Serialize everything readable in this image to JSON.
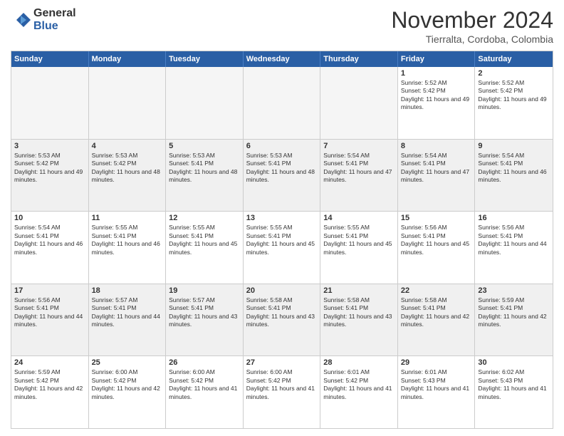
{
  "logo": {
    "general": "General",
    "blue": "Blue"
  },
  "title": "November 2024",
  "location": "Tierralta, Cordoba, Colombia",
  "header_days": [
    "Sunday",
    "Monday",
    "Tuesday",
    "Wednesday",
    "Thursday",
    "Friday",
    "Saturday"
  ],
  "weeks": [
    [
      {
        "day": "",
        "empty": true
      },
      {
        "day": "",
        "empty": true
      },
      {
        "day": "",
        "empty": true
      },
      {
        "day": "",
        "empty": true
      },
      {
        "day": "",
        "empty": true
      },
      {
        "day": "1",
        "sunrise": "Sunrise: 5:52 AM",
        "sunset": "Sunset: 5:42 PM",
        "daylight": "Daylight: 11 hours and 49 minutes."
      },
      {
        "day": "2",
        "sunrise": "Sunrise: 5:52 AM",
        "sunset": "Sunset: 5:42 PM",
        "daylight": "Daylight: 11 hours and 49 minutes."
      }
    ],
    [
      {
        "day": "3",
        "sunrise": "Sunrise: 5:53 AM",
        "sunset": "Sunset: 5:42 PM",
        "daylight": "Daylight: 11 hours and 49 minutes."
      },
      {
        "day": "4",
        "sunrise": "Sunrise: 5:53 AM",
        "sunset": "Sunset: 5:42 PM",
        "daylight": "Daylight: 11 hours and 48 minutes."
      },
      {
        "day": "5",
        "sunrise": "Sunrise: 5:53 AM",
        "sunset": "Sunset: 5:41 PM",
        "daylight": "Daylight: 11 hours and 48 minutes."
      },
      {
        "day": "6",
        "sunrise": "Sunrise: 5:53 AM",
        "sunset": "Sunset: 5:41 PM",
        "daylight": "Daylight: 11 hours and 48 minutes."
      },
      {
        "day": "7",
        "sunrise": "Sunrise: 5:54 AM",
        "sunset": "Sunset: 5:41 PM",
        "daylight": "Daylight: 11 hours and 47 minutes."
      },
      {
        "day": "8",
        "sunrise": "Sunrise: 5:54 AM",
        "sunset": "Sunset: 5:41 PM",
        "daylight": "Daylight: 11 hours and 47 minutes."
      },
      {
        "day": "9",
        "sunrise": "Sunrise: 5:54 AM",
        "sunset": "Sunset: 5:41 PM",
        "daylight": "Daylight: 11 hours and 46 minutes."
      }
    ],
    [
      {
        "day": "10",
        "sunrise": "Sunrise: 5:54 AM",
        "sunset": "Sunset: 5:41 PM",
        "daylight": "Daylight: 11 hours and 46 minutes."
      },
      {
        "day": "11",
        "sunrise": "Sunrise: 5:55 AM",
        "sunset": "Sunset: 5:41 PM",
        "daylight": "Daylight: 11 hours and 46 minutes."
      },
      {
        "day": "12",
        "sunrise": "Sunrise: 5:55 AM",
        "sunset": "Sunset: 5:41 PM",
        "daylight": "Daylight: 11 hours and 45 minutes."
      },
      {
        "day": "13",
        "sunrise": "Sunrise: 5:55 AM",
        "sunset": "Sunset: 5:41 PM",
        "daylight": "Daylight: 11 hours and 45 minutes."
      },
      {
        "day": "14",
        "sunrise": "Sunrise: 5:55 AM",
        "sunset": "Sunset: 5:41 PM",
        "daylight": "Daylight: 11 hours and 45 minutes."
      },
      {
        "day": "15",
        "sunrise": "Sunrise: 5:56 AM",
        "sunset": "Sunset: 5:41 PM",
        "daylight": "Daylight: 11 hours and 45 minutes."
      },
      {
        "day": "16",
        "sunrise": "Sunrise: 5:56 AM",
        "sunset": "Sunset: 5:41 PM",
        "daylight": "Daylight: 11 hours and 44 minutes."
      }
    ],
    [
      {
        "day": "17",
        "sunrise": "Sunrise: 5:56 AM",
        "sunset": "Sunset: 5:41 PM",
        "daylight": "Daylight: 11 hours and 44 minutes."
      },
      {
        "day": "18",
        "sunrise": "Sunrise: 5:57 AM",
        "sunset": "Sunset: 5:41 PM",
        "daylight": "Daylight: 11 hours and 44 minutes."
      },
      {
        "day": "19",
        "sunrise": "Sunrise: 5:57 AM",
        "sunset": "Sunset: 5:41 PM",
        "daylight": "Daylight: 11 hours and 43 minutes."
      },
      {
        "day": "20",
        "sunrise": "Sunrise: 5:58 AM",
        "sunset": "Sunset: 5:41 PM",
        "daylight": "Daylight: 11 hours and 43 minutes."
      },
      {
        "day": "21",
        "sunrise": "Sunrise: 5:58 AM",
        "sunset": "Sunset: 5:41 PM",
        "daylight": "Daylight: 11 hours and 43 minutes."
      },
      {
        "day": "22",
        "sunrise": "Sunrise: 5:58 AM",
        "sunset": "Sunset: 5:41 PM",
        "daylight": "Daylight: 11 hours and 42 minutes."
      },
      {
        "day": "23",
        "sunrise": "Sunrise: 5:59 AM",
        "sunset": "Sunset: 5:41 PM",
        "daylight": "Daylight: 11 hours and 42 minutes."
      }
    ],
    [
      {
        "day": "24",
        "sunrise": "Sunrise: 5:59 AM",
        "sunset": "Sunset: 5:42 PM",
        "daylight": "Daylight: 11 hours and 42 minutes."
      },
      {
        "day": "25",
        "sunrise": "Sunrise: 6:00 AM",
        "sunset": "Sunset: 5:42 PM",
        "daylight": "Daylight: 11 hours and 42 minutes."
      },
      {
        "day": "26",
        "sunrise": "Sunrise: 6:00 AM",
        "sunset": "Sunset: 5:42 PM",
        "daylight": "Daylight: 11 hours and 41 minutes."
      },
      {
        "day": "27",
        "sunrise": "Sunrise: 6:00 AM",
        "sunset": "Sunset: 5:42 PM",
        "daylight": "Daylight: 11 hours and 41 minutes."
      },
      {
        "day": "28",
        "sunrise": "Sunrise: 6:01 AM",
        "sunset": "Sunset: 5:42 PM",
        "daylight": "Daylight: 11 hours and 41 minutes."
      },
      {
        "day": "29",
        "sunrise": "Sunrise: 6:01 AM",
        "sunset": "Sunset: 5:43 PM",
        "daylight": "Daylight: 11 hours and 41 minutes."
      },
      {
        "day": "30",
        "sunrise": "Sunrise: 6:02 AM",
        "sunset": "Sunset: 5:43 PM",
        "daylight": "Daylight: 11 hours and 41 minutes."
      }
    ]
  ]
}
